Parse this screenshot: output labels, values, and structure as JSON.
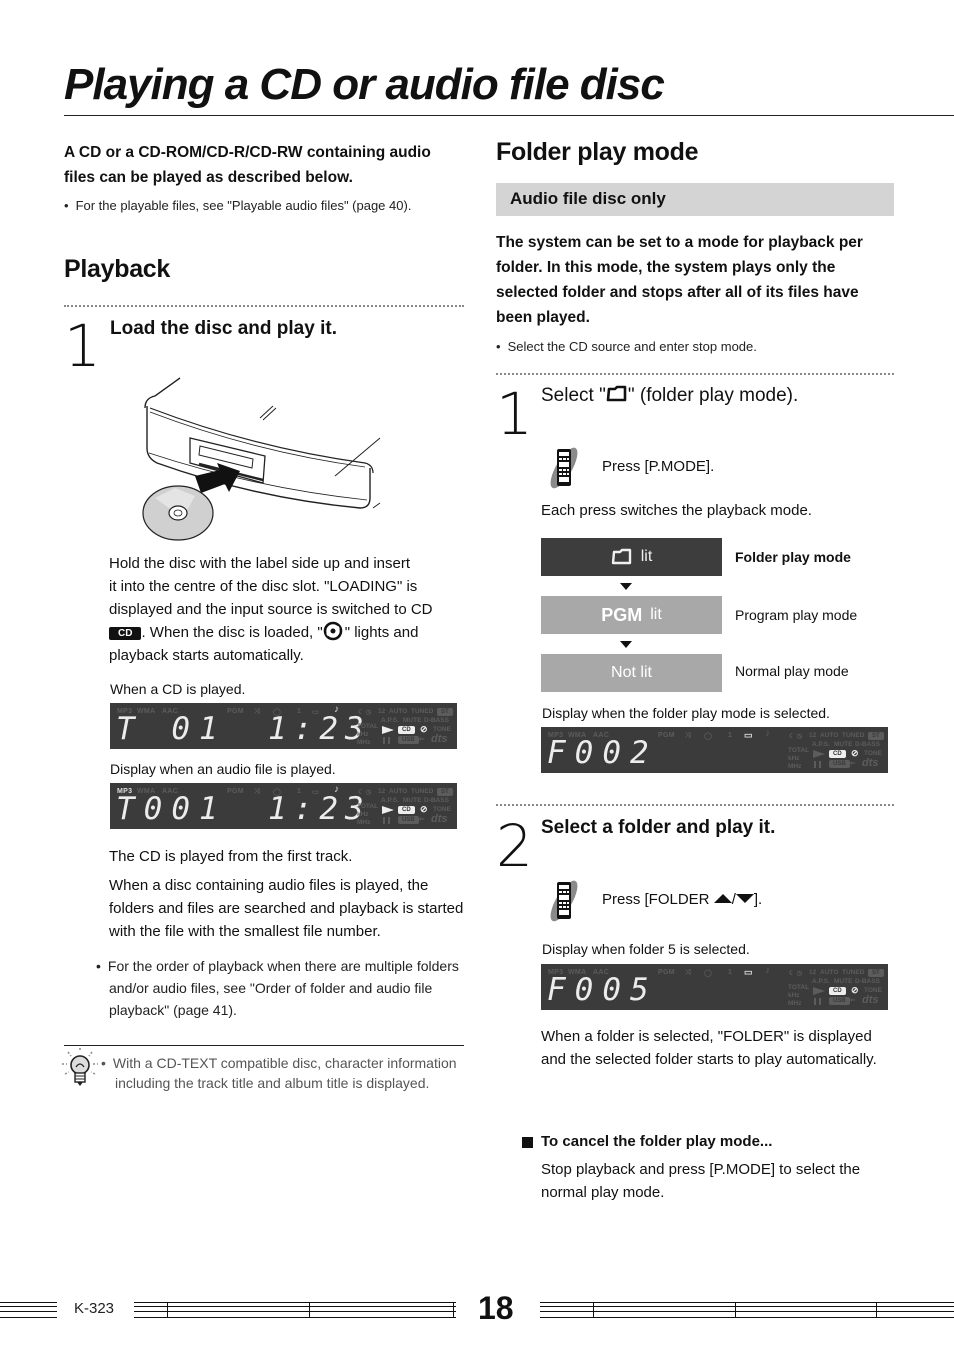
{
  "page": {
    "title": "Playing a CD or audio file disc",
    "model": "K-323",
    "page_number": "18"
  },
  "left": {
    "intro_bold": "A CD or a CD-ROM/CD-R/CD-RW containing audio files can be played as described below.",
    "intro_bullet": "For the playable files, see \"Playable audio files\" (page 40).",
    "section_heading": "Playback",
    "step1": {
      "number": "1",
      "title": "Load the disc and play it.",
      "illustration": "disc-insert-illustration",
      "para_line1": "Hold the disc with the label side up and insert",
      "para_line2": "it into the centre of the disc slot. \"LOADING\" is",
      "para_line3": "displayed and the input source is switched to CD",
      "cd_badge": "CD",
      "para_line4a": ". When the disc is loaded, \"",
      "para_line4b": "\" lights and",
      "para_line5": "playback starts automatically.",
      "display1_caption": "When a CD is played.",
      "display1_text": "T 01",
      "display1_time": "1:23",
      "display2_caption": "Display when an audio file is played.",
      "display2_text": "T001",
      "display2_time": "1:23",
      "after1": "The CD is played from the first track.",
      "after2": "When a disc containing audio files is played, the folders and files are searched and playback is started with the file with the smallest file number.",
      "bullet": "For the order of playback when there are multiple folders and/or audio files, see \"Order of folder and audio file playback\" (page 41).",
      "tip": "With a CD-TEXT compatible disc, character information including the track title and album title is displayed."
    }
  },
  "lcd_labels": {
    "mp3": "MP3",
    "wma": "WMA",
    "aac": "AAC",
    "pgm": "PGM",
    "one": "1",
    "twelve": "12",
    "auto": "AUTO",
    "tuned": "TUNED",
    "st": "ST",
    "aps": "A.P.S.",
    "mute": "MUTE",
    "dbass": "D-BASS",
    "total": "TOTAL",
    "khz": "kHz",
    "mhz": "MHz",
    "cd": "CD",
    "tone": "TONE",
    "usb": "USB",
    "dts": "dts"
  },
  "right": {
    "section_heading": "Folder play mode",
    "banner": "Audio file disc only",
    "intro_bold": "The system can be set to a mode for playback per folder. In this mode, the system plays only the selected folder and stops after all of its files have been played.",
    "intro_bullet": "Select the CD source and enter stop mode.",
    "step1": {
      "number": "1",
      "title_a": "Select \"",
      "title_b": "\" (folder play mode).",
      "press": "Press [P.MODE].",
      "note": "Each press switches the playback mode.",
      "modes": [
        {
          "indicator": "lit",
          "label": "Folder play mode"
        },
        {
          "indicator_bold": "PGM",
          "indicator": "lit",
          "label": "Program play mode"
        },
        {
          "indicator": "Not lit",
          "label": "Normal play mode"
        }
      ],
      "display_caption": "Display when the folder play mode is selected.",
      "display_text": "F002"
    },
    "step2": {
      "number": "2",
      "title": "Select a folder and play it.",
      "press_a": "Press [FOLDER ",
      "press_sep": "/",
      "press_b": "].",
      "display_caption": "Display when folder 5 is selected.",
      "display_text": "F005",
      "para": "When a folder is selected, \"FOLDER\" is displayed and the selected folder starts to play automatically."
    },
    "cancel": {
      "heading": "To cancel the folder play mode...",
      "body": "Stop playback and press [P.MODE] to select the normal play mode."
    }
  },
  "colors": {
    "lcd_bg": "#3b3b3b",
    "banner_bg": "#d4d4d4",
    "mode_active_bg": "#3d3d3d",
    "mode_inactive_bg": "#a8a8a8"
  }
}
